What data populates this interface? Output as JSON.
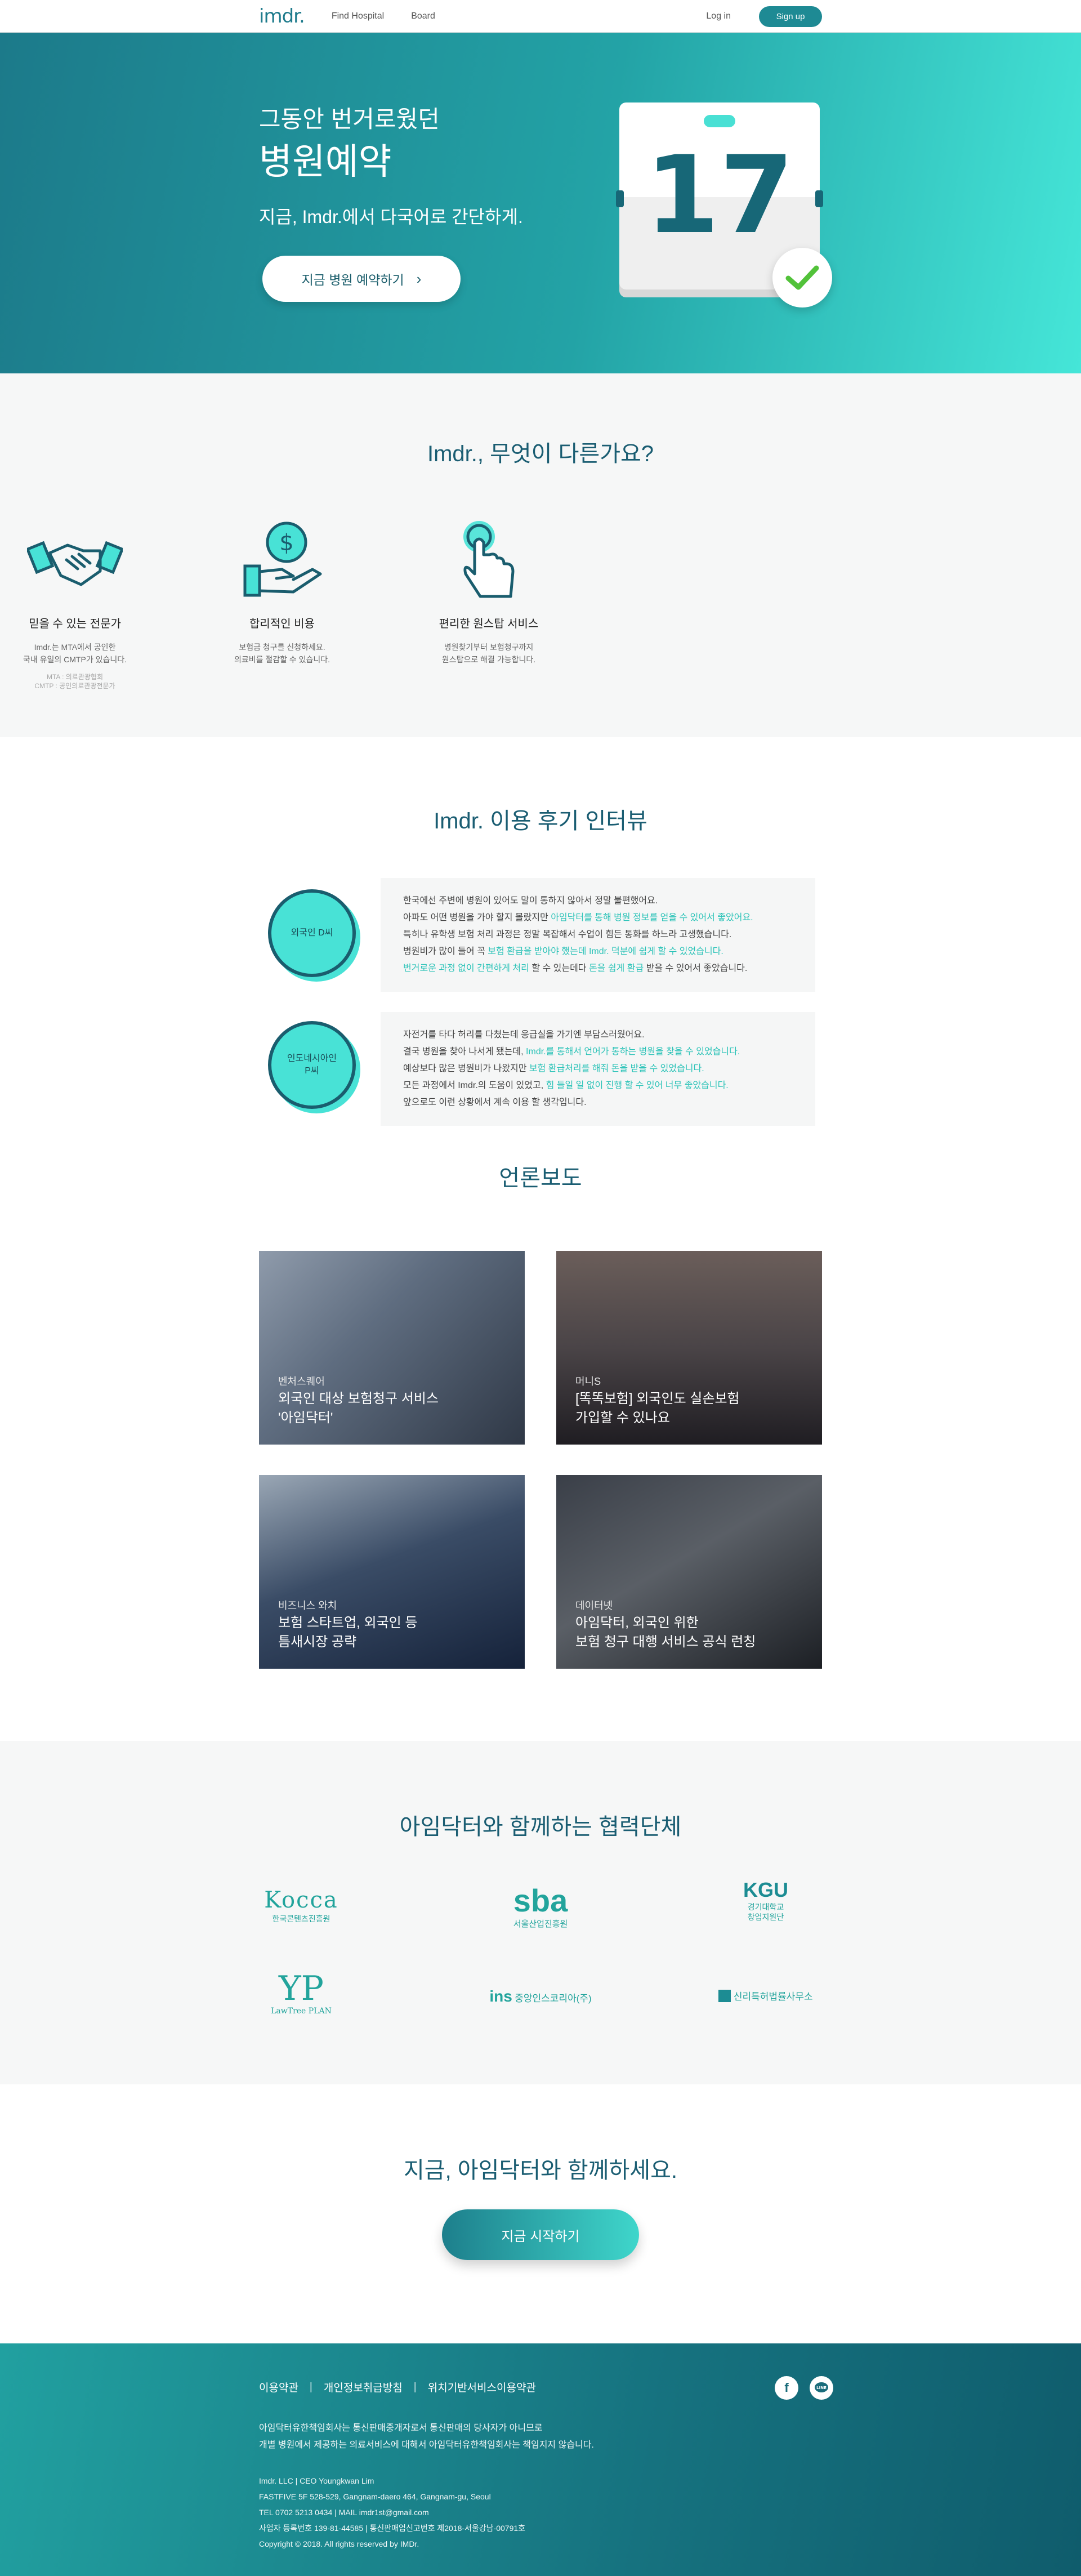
{
  "nav": {
    "logo": "imdr.",
    "links": [
      "Find Hospital",
      "Board"
    ],
    "login": "Log in",
    "signup": "Sign up"
  },
  "hero": {
    "line1": "그동안 번거로웠던",
    "line2": "병원예약",
    "subtitle": "지금, Imdr.에서 다국어로 간단하게.",
    "button": "지금 병원 예약하기",
    "calendar_day": "17"
  },
  "why": {
    "title": "Imdr., 무엇이 다른가요?",
    "features": [
      {
        "icon": "handshake-icon",
        "title": "믿을 수 있는 전문가",
        "desc": "Imdr.는 MTA에서 공인한\n국내 유일의 CMTP가 있습니다.",
        "note": "MTA : 의료관광협회\nCMTP : 공인의료관광전문가"
      },
      {
        "icon": "money-hand-icon",
        "title": "합리적인 비용",
        "desc": "보험금 청구를 신청하세요.\n의료비를 절감할 수 있습니다.",
        "note": ""
      },
      {
        "icon": "tap-hand-icon",
        "title": "편리한 원스탑 서비스",
        "desc": "병원찾기부터 보험청구까지\n원스탑으로 해결 가능합니다.",
        "note": ""
      }
    ]
  },
  "reviews": {
    "title": "Imdr. 이용 후기 인터뷰",
    "items": [
      {
        "avatar": "외국인 D씨",
        "lines": [
          [
            [
              "한국에선 주변에 병원이 있어도 말이 통하지 않아서 정말 불편했어요.",
              false
            ]
          ],
          [
            [
              "아파도 어떤 병원을 가야 할지 몰랐지만 ",
              false
            ],
            [
              "아임닥터를 통해 병원 정보를 얻을 수 있어서 좋았어요.",
              true
            ]
          ],
          [
            [
              "특히나 유학생 보험 처리 과정은 정말 복잡해서 수업이 힘든 통화를 하느라 고생했습니다.",
              false
            ]
          ],
          [
            [
              "병원비가 많이 들어 꼭 ",
              false
            ],
            [
              "보험 환급을 받아야 했는데 Imdr. 덕분에 쉽게 할 수 있었습니다.",
              true
            ]
          ],
          [
            [
              "번거로운 과정 없이 간편하게 처리",
              true
            ],
            [
              " 할 수 있는데다 ",
              false
            ],
            [
              "돈을 쉽게 환급",
              true
            ],
            [
              " 받을 수 있어서 좋았습니다.",
              false
            ]
          ]
        ]
      },
      {
        "avatar": "인도네시아인 P씨",
        "lines": [
          [
            [
              "자전거를 타다 허리를 다쳤는데 응급실을 가기엔 부담스러웠어요.",
              false
            ]
          ],
          [
            [
              "결국 병원을 찾아 나서게 됐는데, ",
              false
            ],
            [
              "Imdr.를 통해서 언어가 통하는 병원을 찾을 수 있었습니다.",
              true
            ]
          ],
          [
            [
              "예상보다 많은 병원비가 나왔지만 ",
              false
            ],
            [
              "보험 환급처리를 해줘 돈을 받을 수 있었습니다.",
              true
            ]
          ],
          [
            [
              "모든 과정에서 Imdr.의 도움이 있었고, ",
              false
            ],
            [
              "힘 들일 일 없이 진행 할 수 있어 너무 좋았습니다.",
              true
            ]
          ],
          [
            [
              "앞으로도 이런 상황에서 계속 이용 할 생각입니다.",
              false
            ]
          ]
        ]
      }
    ]
  },
  "press": {
    "title": "언론보도",
    "articles": [
      {
        "source": "벤처스퀘어",
        "title": "외국인 대상 보험청구 서비스\n'아임닥터'"
      },
      {
        "source": "머니S",
        "title": "[똑똑보험] 외국인도 실손보험\n가입할 수 있나요"
      },
      {
        "source": "비즈니스 와치",
        "title": "보험 스타트업, 외국인 등\n틈새시장 공략"
      },
      {
        "source": "데이터넷",
        "title": "아임닥터, 외국인 위한\n보험 청구 대행 서비스 공식 런칭"
      }
    ]
  },
  "partners": {
    "title": "아임닥터와 함께하는 협력단체",
    "logos": [
      {
        "name": "Kocca",
        "sub": "한국콘텐츠진흥원"
      },
      {
        "name": "sba",
        "sub": "서울산업진흥원"
      },
      {
        "name": "KGU",
        "sub": "경기대학교\n창업지원단"
      },
      {
        "name": "LawTree PLAN",
        "sub": ""
      },
      {
        "name": "ins",
        "sub": "중앙인스코리아(주)"
      },
      {
        "name": "신리특허법률사무소",
        "sub": ""
      }
    ]
  },
  "cta": {
    "title": "지금, 아임닥터와 함께하세요.",
    "button": "지금 시작하기"
  },
  "footer": {
    "links": [
      "이용약관",
      "개인정보취급방침",
      "위치기반서비스이용약관"
    ],
    "social": [
      "facebook-icon",
      "line-icon"
    ],
    "notice": [
      "아임닥터유한책임회사는 통신판매중개자로서 통신판매의 당사자가 아니므로",
      "개별 병원에서 제공하는 의료서비스에 대해서 아임닥터유한책임회사는 책임지지 않습니다."
    ],
    "info": [
      "Imdr. LLC | CEO Youngkwan Lim",
      "FASTFIVE 5F 528-529, Gangnam-daero 464, Gangnam-gu, Seoul",
      "TEL 0702 5213 0434 | MAIL imdr1st@gmail.com",
      "사업자 등록번호 139-81-44585 | 통신판매업신고번호 제2018-서울강남-00791호",
      "Copyright © 2018. All rights reserved by IMDr."
    ]
  },
  "colors": {
    "brand": "#1e8a94",
    "accent": "#45e6d8",
    "title": "#1a5d72"
  }
}
